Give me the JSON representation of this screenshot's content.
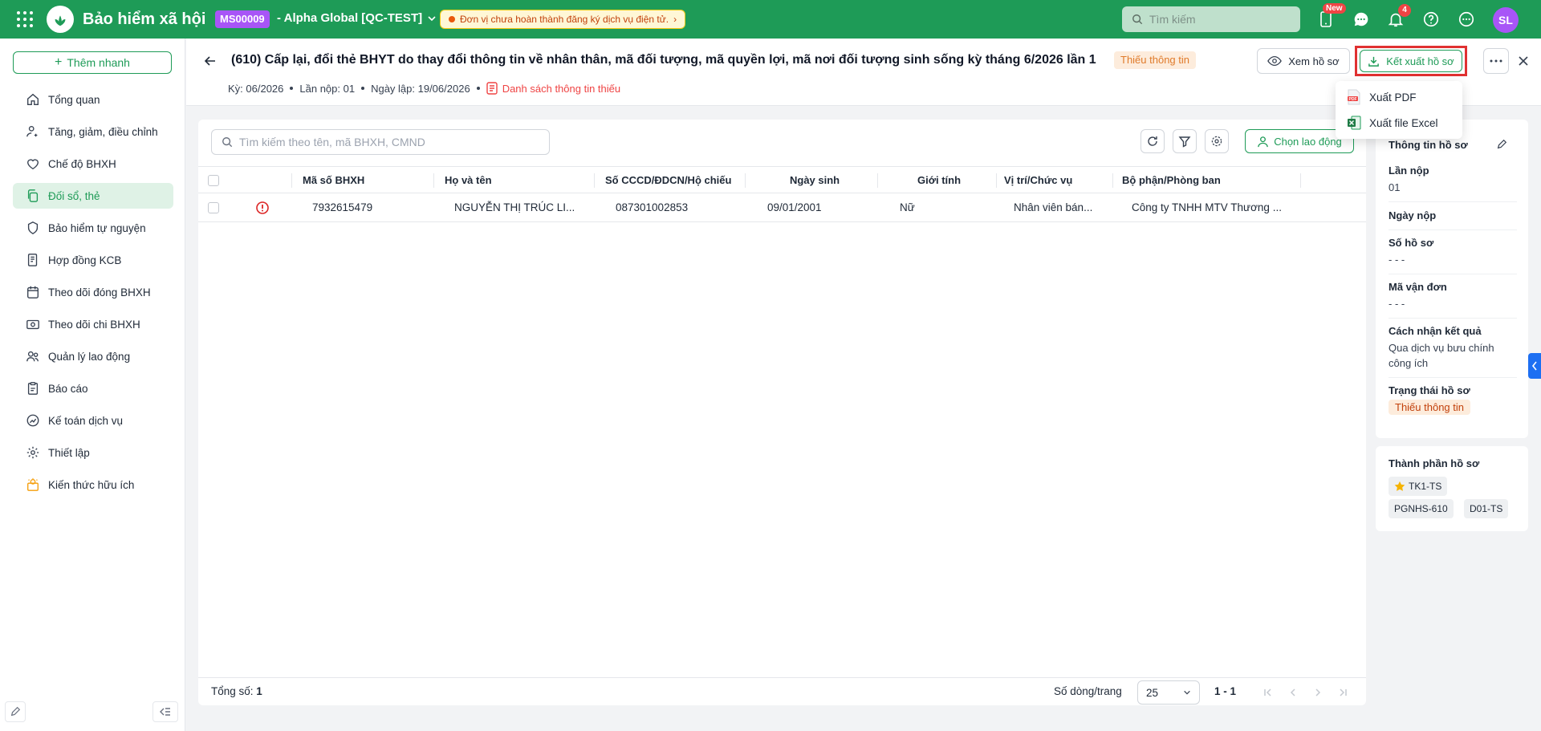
{
  "topbar": {
    "app_title": "Bảo hiểm xã hội",
    "org_code": "MS00009",
    "org_name": "- Alpha Global [QC-TEST]",
    "warning": "Đơn vị chưa hoàn thành đăng ký dịch vụ điện tử.",
    "search_placeholder": "Tìm kiếm",
    "new_badge": "New",
    "notification_count": "4",
    "avatar_initials": "SL",
    "brand_color": "#1e9b57"
  },
  "sidebar": {
    "quick_add": "Thêm nhanh",
    "items": [
      {
        "label": "Tổng quan",
        "icon": "home-icon"
      },
      {
        "label": "Tăng, giảm, điều chỉnh",
        "icon": "user-adjust-icon"
      },
      {
        "label": "Chế độ BHXH",
        "icon": "heart-icon"
      },
      {
        "label": "Đối sổ, thẻ",
        "icon": "copy-icon",
        "active": true
      },
      {
        "label": "Bảo hiểm tự nguyện",
        "icon": "shield-icon"
      },
      {
        "label": "Hợp đồng KCB",
        "icon": "contract-icon"
      },
      {
        "label": "Theo dõi đóng BHXH",
        "icon": "calendar-icon"
      },
      {
        "label": "Theo dõi chi BHXH",
        "icon": "money-icon"
      },
      {
        "label": "Quản lý lao động",
        "icon": "users-icon"
      },
      {
        "label": "Báo cáo",
        "icon": "clipboard-icon"
      },
      {
        "label": "Kế toán dịch vụ",
        "icon": "chart-icon"
      },
      {
        "label": "Thiết lập",
        "icon": "gear-icon"
      },
      {
        "label": "Kiến thức hữu ích",
        "icon": "idea-icon"
      }
    ]
  },
  "header": {
    "title": "(610) Cấp lại, đổi thẻ BHYT do thay đổi thông tin về nhân thân, mã đối tượng, mã quyền lợi, mã nơi đối tượng sinh sống kỳ tháng 6/2026 lần 1",
    "status_badge": "Thiếu thông tin",
    "period": "Kỳ: 06/2026",
    "submission": "Lần nộp: 01",
    "created_date": "Ngày lập: 19/06/2026",
    "missing_list_link": "Danh sách thông tin thiếu",
    "view_button": "Xem hồ sơ",
    "export_button": "Kết xuất hồ sơ"
  },
  "export_menu": {
    "items": [
      {
        "label": "Xuất PDF",
        "icon": "pdf-icon"
      },
      {
        "label": "Xuất file Excel",
        "icon": "excel-icon"
      }
    ]
  },
  "table": {
    "search_placeholder": "Tìm kiếm theo tên, mã BHXH, CMND",
    "choose_button": "Chọn lao động",
    "columns": [
      "Mã số BHXH",
      "Họ và tên",
      "Số CCCD/ĐDCN/Hộ chiếu",
      "Ngày sinh",
      "Giới tính",
      "Vị trí/Chức vụ",
      "Bộ phận/Phòng ban"
    ],
    "rows": [
      [
        "7932615479",
        "NGUYỄN THỊ TRÚC LI...",
        "087301002853",
        "09/01/2001",
        "Nữ",
        "Nhân viên bán...",
        "Công ty TNHH MTV Thương ..."
      ]
    ],
    "total_label": "Tổng số:",
    "total_value": "1",
    "rows_per_page_label": "Số dòng/trang",
    "rows_per_page": "25",
    "range": "1 - 1"
  },
  "panel": {
    "title": "Thông tin hồ sơ",
    "fields": [
      {
        "label": "Lần nộp",
        "value": "01"
      },
      {
        "label": "Ngày nộp",
        "value": ""
      },
      {
        "label": "Số hồ sơ",
        "value": "- - -"
      },
      {
        "label": "Mã vận đơn",
        "value": "- - -"
      },
      {
        "label": "Cách nhận kết quả",
        "value": "Qua dịch vụ bưu chính công ích"
      },
      {
        "label": "Trạng thái hồ sơ",
        "value": "Thiếu thông tin"
      }
    ],
    "components_title": "Thành phần hồ sơ",
    "components": [
      "TK1-TS",
      "PGNHS-610",
      "D01-TS"
    ]
  }
}
